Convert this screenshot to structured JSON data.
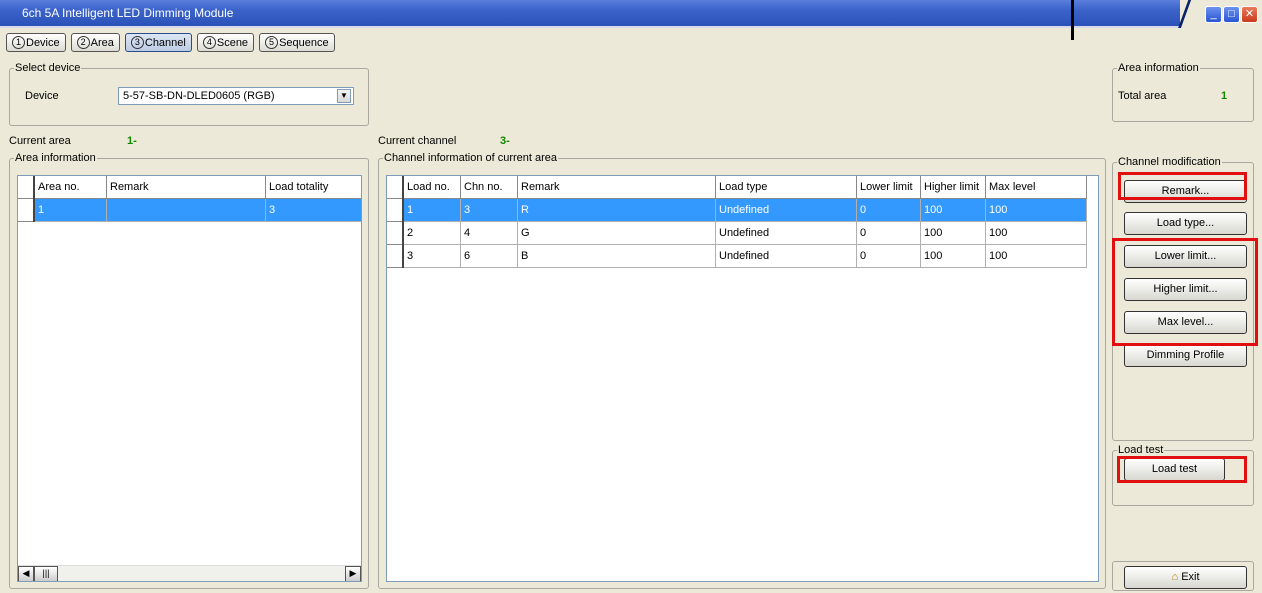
{
  "window": {
    "title": "6ch 5A Intelligent LED Dimming Module"
  },
  "tabs": [
    {
      "num": "1",
      "label": "Device"
    },
    {
      "num": "2",
      "label": "Area"
    },
    {
      "num": "3",
      "label": "Channel"
    },
    {
      "num": "4",
      "label": "Scene"
    },
    {
      "num": "5",
      "label": "Sequence"
    }
  ],
  "select_device": {
    "legend": "Select device",
    "device_label": "Device",
    "device_value": "5-57-SB-DN-DLED0605 (RGB)"
  },
  "area_info_top": {
    "legend": "Area information",
    "total_label": "Total area",
    "total_value": "1"
  },
  "current_area": {
    "label": "Current area",
    "value": "1-"
  },
  "current_channel": {
    "label": "Current channel",
    "value": "3-"
  },
  "area_table": {
    "legend": "Area information",
    "headers": [
      "Area no.",
      "Remark",
      "Load totality"
    ],
    "rows": [
      [
        "1",
        "",
        "3"
      ]
    ]
  },
  "channel_table": {
    "legend": "Channel information of current area",
    "headers": [
      "Load no.",
      "Chn no.",
      "Remark",
      "Load type",
      "Lower limit",
      "Higher limit",
      "Max level"
    ],
    "rows": [
      [
        "1",
        "3",
        "R",
        "Undefined",
        "0",
        "100",
        "100"
      ],
      [
        "2",
        "4",
        "G",
        "Undefined",
        "0",
        "100",
        "100"
      ],
      [
        "3",
        "6",
        "B",
        "Undefined",
        "0",
        "100",
        "100"
      ]
    ]
  },
  "channel_mod": {
    "legend": "Channel modification",
    "remark": "Remark...",
    "load_type": "Load type...",
    "lower_limit": "Lower limit...",
    "higher_limit": "Higher limit...",
    "max_level": "Max level...",
    "dimming_profile": "Dimming Profile"
  },
  "load_test": {
    "legend": "Load test",
    "button": "Load test"
  },
  "exit": {
    "label": "Exit"
  },
  "colors": {
    "highlight": "#e01010",
    "selection": "#3399ff",
    "value_green": "#118800"
  }
}
